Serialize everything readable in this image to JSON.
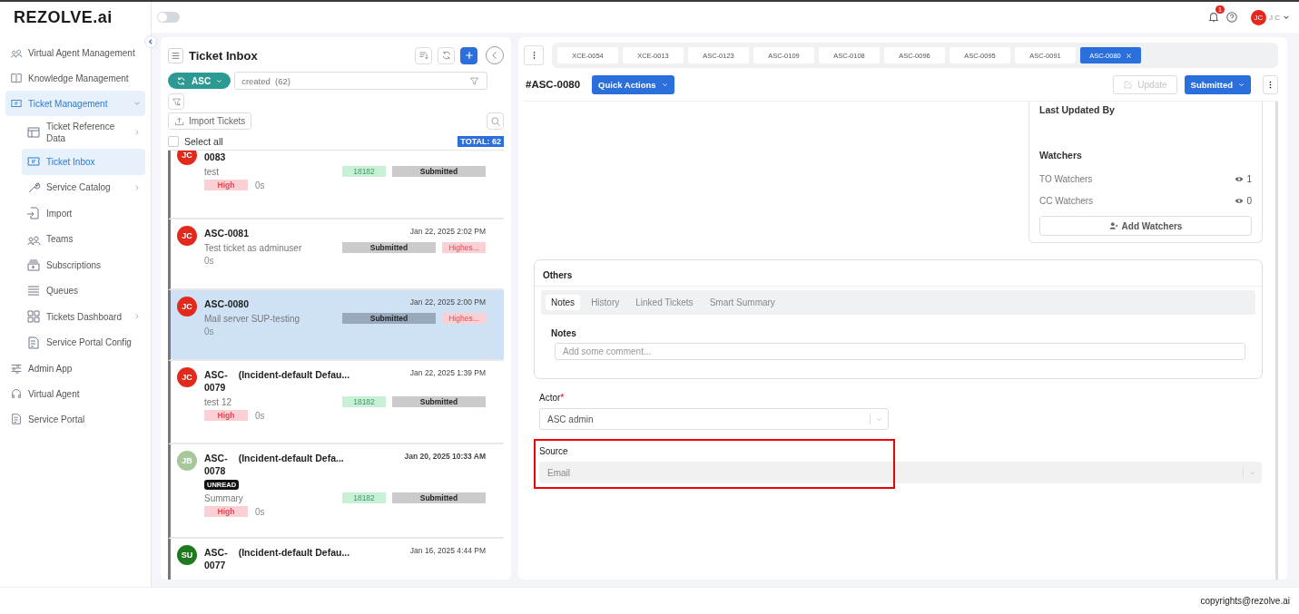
{
  "topbar": {
    "logo": "REZOLVE.ai",
    "toggle": {
      "on": false
    },
    "notification_count": "1",
    "user": {
      "initials": "JC",
      "label": "J C"
    }
  },
  "sidebar": {
    "items": [
      {
        "label": "Virtual Agent Management",
        "selected": false
      },
      {
        "label": "Knowledge Management",
        "selected": false
      },
      {
        "label": "Ticket Management",
        "selected": true,
        "expanded": true,
        "children": [
          {
            "label": "Ticket Reference Data",
            "selected": false,
            "expanded": false
          },
          {
            "label": "Ticket Inbox",
            "selected": true
          },
          {
            "label": "Service Catalog",
            "selected": false,
            "expanded": false
          },
          {
            "label": "Import",
            "selected": false
          },
          {
            "label": "Teams",
            "selected": false
          },
          {
            "label": "Subscriptions",
            "selected": false
          },
          {
            "label": "Queues",
            "selected": false
          },
          {
            "label": "Tickets Dashboard",
            "selected": false,
            "expanded": false
          },
          {
            "label": "Service Portal Config",
            "selected": false
          }
        ]
      },
      {
        "label": "Admin App",
        "selected": false
      },
      {
        "label": "Virtual Agent",
        "selected": false
      },
      {
        "label": "Service Portal",
        "selected": false
      }
    ]
  },
  "inbox": {
    "title": "Ticket Inbox",
    "queue_chip": "ASC",
    "filter": {
      "value": "created  (62)"
    },
    "import_button": "Import Tickets",
    "select_all": {
      "label": "Select all",
      "checked": false
    },
    "total": "TOTAL: 62",
    "tickets": [
      {
        "kind": "incident",
        "initials": "JC",
        "color": "#e3281c",
        "id": "0083",
        "summary": "test",
        "ref": "18182",
        "status": "Submitted",
        "priority": "High",
        "age": "0s",
        "unread": false,
        "selected": false
      },
      {
        "kind": "simple",
        "initials": "JC",
        "color": "#e3281c",
        "id": "ASC-0081",
        "date": "Jan 22, 2025 2:02 PM",
        "summary": "Test ticket as adminuser",
        "status": "Submitted",
        "priority": "Highes...",
        "age": "0s",
        "unread": false,
        "selected": false
      },
      {
        "kind": "simple",
        "initials": "JC",
        "color": "#e3281c",
        "id": "ASC-0080",
        "date": "Jan 22, 2025 2:00 PM",
        "summary": "Mail server SUP-testing",
        "status": "Submitted",
        "priority": "Highes...",
        "age": "0s",
        "unread": false,
        "selected": true
      },
      {
        "kind": "incident",
        "initials": "JC",
        "color": "#e3281c",
        "id": "ASC-\n0079",
        "title": "(Incident-default Defau...",
        "date": "Jan 22, 2025 1:39 PM",
        "summary": "test 12",
        "ref": "18182",
        "status": "Submitted",
        "priority": "High",
        "age": "0s",
        "unread": false,
        "selected": false
      },
      {
        "kind": "incident",
        "initials": "JB",
        "color": "#a8c79a",
        "id": "ASC-\n0078",
        "title": "(Incident-default Defa...",
        "date": "Jan 20, 2025 10:33 AM",
        "unread_label": "UNREAD",
        "unread": true,
        "summary": "Summary",
        "ref": "18182",
        "status": "Submitted",
        "priority": "High",
        "age": "0s",
        "selected": false
      },
      {
        "kind": "incident",
        "initials": "SU",
        "color": "#1e7a1e",
        "id": "ASC-\n0077",
        "title": "(Incident-default Defau...",
        "date": "Jan 16, 2025 4:44 PM",
        "unread": false,
        "selected": false
      }
    ]
  },
  "detail": {
    "tabs": [
      {
        "label": "XCE-0054",
        "selected": false
      },
      {
        "label": "XCE-0013",
        "selected": false
      },
      {
        "label": "ASC-0123",
        "selected": false
      },
      {
        "label": "ASC-0109",
        "selected": false
      },
      {
        "label": "ASC-0108",
        "selected": false
      },
      {
        "label": "ASC-0096",
        "selected": false
      },
      {
        "label": "ASC-0095",
        "selected": false
      },
      {
        "label": "ASC-0091",
        "selected": false
      },
      {
        "label": "ASC-0080",
        "selected": true
      }
    ],
    "ticket_id": "#ASC-0080",
    "quick_actions": "Quick Actions",
    "update_button": {
      "label": "Update",
      "disabled": true
    },
    "status_button": "Submitted",
    "last_updated_by": "Last Updated By",
    "watchers": {
      "title": "Watchers",
      "rows": [
        {
          "label": "TO Watchers",
          "count": "1"
        },
        {
          "label": "CC Watchers",
          "count": "0"
        }
      ],
      "add_button": "Add Watchers"
    },
    "others": {
      "title": "Others",
      "tabs": [
        {
          "label": "Notes",
          "selected": true
        },
        {
          "label": "History",
          "selected": false
        },
        {
          "label": "Linked Tickets",
          "selected": false
        },
        {
          "label": "Smart Summary",
          "selected": false
        }
      ],
      "notes_label": "Notes",
      "notes_placeholder": "Add some comment..."
    },
    "fields": [
      {
        "label": "Actor",
        "required_mark": "*",
        "value": "ASC admin",
        "disabled": false,
        "highlighted": false
      },
      {
        "label": "Source",
        "value": "Email",
        "disabled": true,
        "highlighted": true
      }
    ]
  },
  "footer": "copyrights@rezolve.ai"
}
